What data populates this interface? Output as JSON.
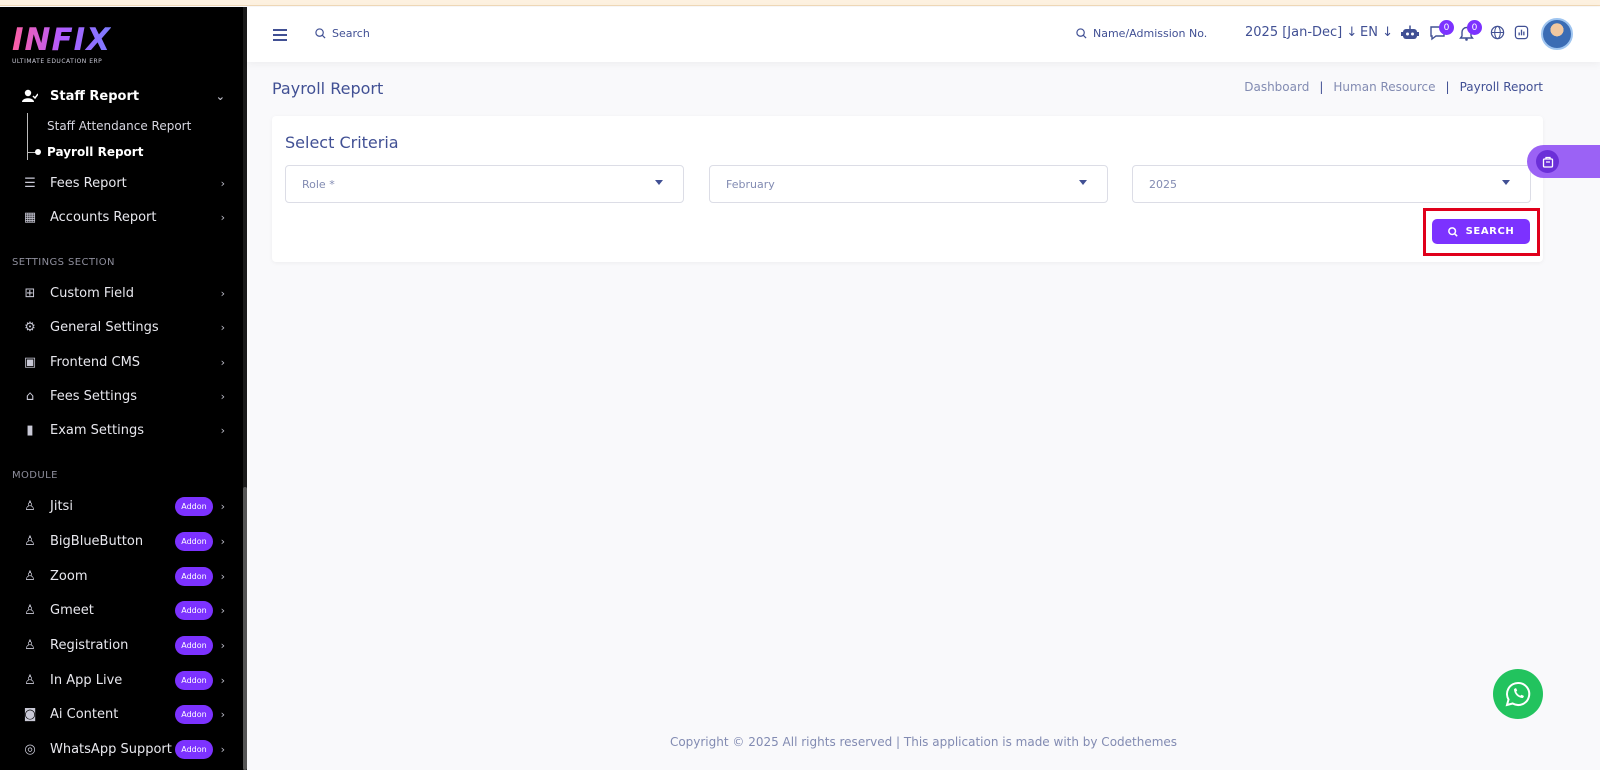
{
  "brand": {
    "logo": "INFIX",
    "tagline": "ULTIMATE EDUCATION ERP"
  },
  "sidebar": {
    "staff_report": "Staff Report",
    "sub_items": [
      "Staff Attendance Report",
      "Payroll Report"
    ],
    "fees_report": "Fees Report",
    "accounts_report": "Accounts Report",
    "settings_label": "SETTINGS SECTION",
    "settings": [
      "Custom Field",
      "General Settings",
      "Frontend CMS",
      "Fees Settings",
      "Exam Settings"
    ],
    "module_label": "MODULE",
    "modules": [
      "Jitsi",
      "BigBlueButton",
      "Zoom",
      "Gmeet",
      "Registration",
      "In App Live",
      "Ai Content",
      "WhatsApp Support"
    ],
    "addon_label": "Addon"
  },
  "header": {
    "search_label": "Search",
    "admission_search": "Name/Admission No.",
    "academic_year": "2025 [Jan-Dec]",
    "language": "EN",
    "chat_count": "0",
    "notification_count": "0"
  },
  "page": {
    "title": "Payroll Report",
    "breadcrumb": [
      "Dashboard",
      "Human Resource",
      "Payroll Report"
    ],
    "breadcrumb_sep": "|"
  },
  "criteria": {
    "title": "Select Criteria",
    "role": "Role *",
    "month": "February",
    "year": "2025",
    "search_button": "SEARCH"
  },
  "footer": {
    "text": "Copyright © 2025 All rights reserved | This application is made with by Codethemes"
  }
}
